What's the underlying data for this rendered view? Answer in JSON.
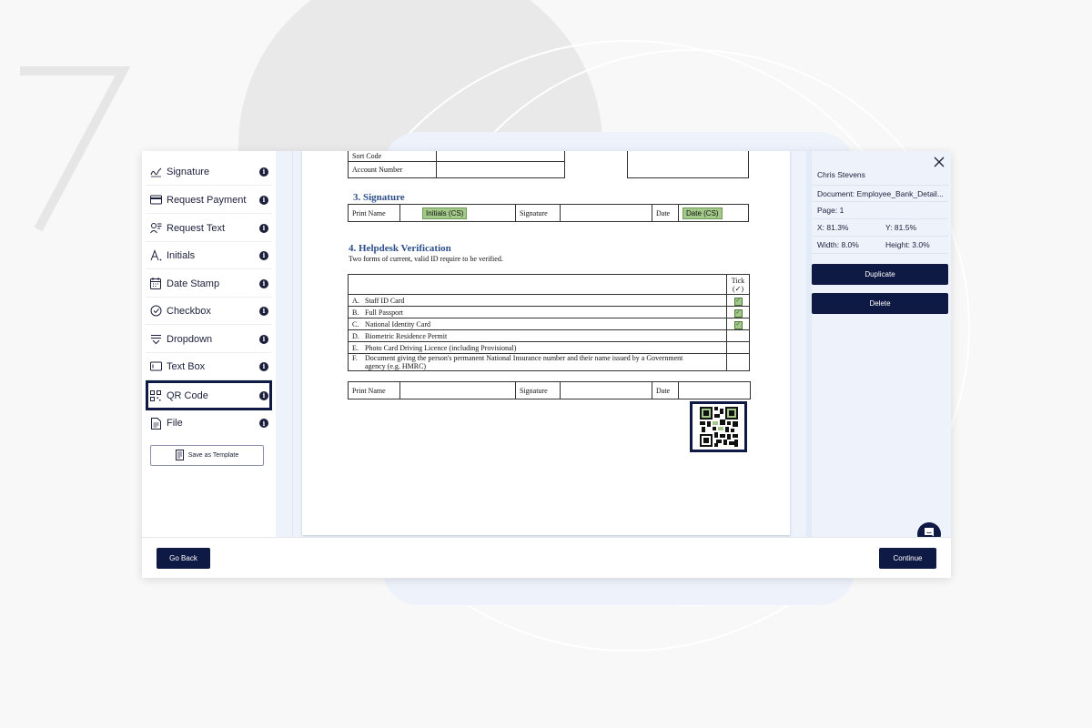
{
  "tools": [
    {
      "label": "Signature",
      "icon": "signature-icon"
    },
    {
      "label": "Request Payment",
      "icon": "card-icon"
    },
    {
      "label": "Request Text",
      "icon": "request-text-icon"
    },
    {
      "label": "Initials",
      "icon": "initials-icon"
    },
    {
      "label": "Date Stamp",
      "icon": "calendar-icon"
    },
    {
      "label": "Checkbox",
      "icon": "checkbox-icon"
    },
    {
      "label": "Dropdown",
      "icon": "dropdown-icon"
    },
    {
      "label": "Text Box",
      "icon": "textbox-icon"
    },
    {
      "label": "QR Code",
      "icon": "qr-code-icon",
      "active": true
    },
    {
      "label": "File",
      "icon": "file-icon"
    }
  ],
  "save_template_label": "Save as Template",
  "document": {
    "bank_rows": [
      "Sort Code",
      "Account Number"
    ],
    "signature_section": {
      "title": "3. Signature",
      "print_name_label": "Print Name",
      "initials_field": "Initials (CS)",
      "signature_label": "Signature",
      "date_label": "Date",
      "date_field": "Date (CS)"
    },
    "helpdesk_section": {
      "title": "4. Helpdesk Verification",
      "note": "Two forms of current, valid ID require to be verified.",
      "tick_header": "Tick",
      "tick_symbol": "(✓)",
      "id_rows": [
        {
          "letter": "A.",
          "text": "Staff ID Card",
          "checked": true
        },
        {
          "letter": "B.",
          "text": "Full Passport",
          "checked": true
        },
        {
          "letter": "C.",
          "text": "National Identity Card",
          "checked": true
        },
        {
          "letter": "D.",
          "text": "Biometric Residence Permit",
          "checked": false
        },
        {
          "letter": "E.",
          "text": "Photo Card Driving Licence (including Provisional)",
          "checked": false
        },
        {
          "letter": "F.",
          "text": "Document giving the person's permanent National Insurance number and their name issued by a Government agency (e.g. HMRC)",
          "checked": false
        }
      ],
      "print_name_label": "Print Name",
      "signature_label": "Signature",
      "date_label": "Date"
    }
  },
  "properties": {
    "signer": "Chris Stevens",
    "document": "Document: Employee_Bank_Detail...",
    "page": "Page: 1",
    "x": "X: 81.3%",
    "y": "Y: 81.5%",
    "width": "Width: 8.0%",
    "height": "Height: 3.0%",
    "duplicate_label": "Duplicate",
    "delete_label": "Delete"
  },
  "footer": {
    "go_back_label": "Go Back",
    "continue_label": "Continue"
  },
  "colors": {
    "navy": "#0f1a44",
    "field_green": "#a3c98a",
    "section_blue": "#2c4f8a",
    "panel_bg": "#eef3fb"
  }
}
